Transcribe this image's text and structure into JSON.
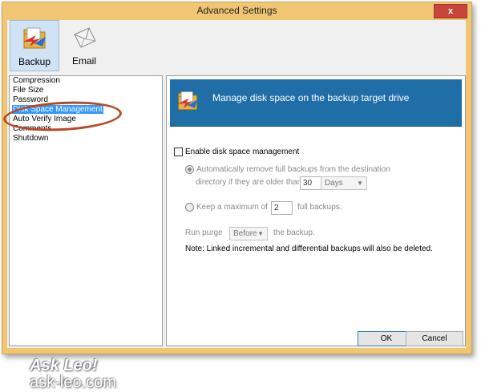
{
  "window": {
    "title": "Advanced Settings",
    "close_label": "x"
  },
  "toolbar": {
    "items": [
      {
        "label": "Backup",
        "icon": "backup-folder-icon"
      },
      {
        "label": "Email",
        "icon": "envelope-icon"
      }
    ]
  },
  "nav": {
    "items": [
      "Compression",
      "File Size",
      "Password",
      "Disk Space Management",
      "Auto Verify Image",
      "Comments",
      "Shutdown"
    ],
    "selected": "Disk Space Management"
  },
  "banner": {
    "text": "Manage disk space on the backup target drive",
    "icon": "backup-folder-icon"
  },
  "form": {
    "enable_label": "Enable disk space management",
    "auto_remove_line1": "Automatically remove full backups from the destination",
    "auto_remove_line2": "directory if they are older than",
    "age_value": "30",
    "age_unit": "Days",
    "keep_max_label": "Keep a maximum of",
    "keep_max_value": "2",
    "keep_max_suffix": "full backups.",
    "purge_label": "Run purge",
    "purge_value": "Before",
    "purge_suffix": "the backup.",
    "note": "Note: Linked incremental and differential backups will also be deleted."
  },
  "buttons": {
    "ok": "OK",
    "cancel": "Cancel"
  },
  "watermark": {
    "line1": "Ask Leo!",
    "line2": "ask-leo.com"
  },
  "colors": {
    "frame": "#f0c675",
    "banner": "#1f6ea8",
    "selection": "#3399ff",
    "highlight_oval": "#b84a22"
  }
}
